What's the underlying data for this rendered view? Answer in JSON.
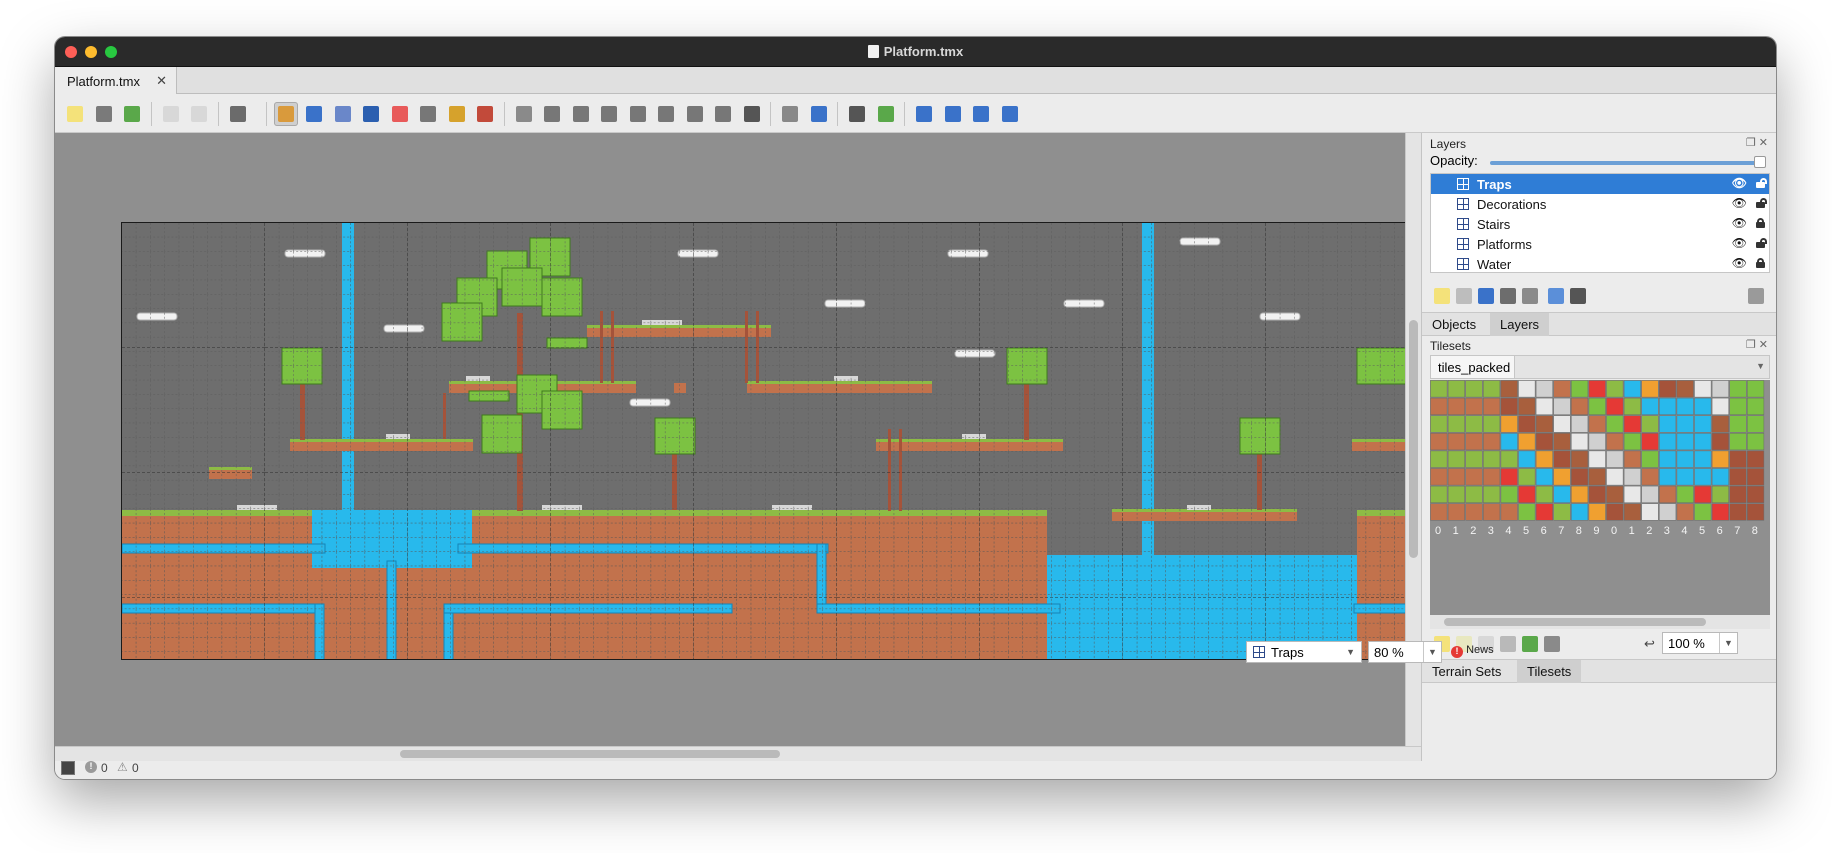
{
  "window": {
    "title": "Platform.tmx"
  },
  "tabs": [
    {
      "label": "Platform.tmx"
    }
  ],
  "toolbar": {
    "groups": [
      [
        "new-map-icon",
        "open-icon",
        "save-icon"
      ],
      [
        "undo-icon",
        "redo-icon"
      ],
      [
        "commands-icon"
      ],
      [
        "stamp-brush-icon",
        "terrain-brush-icon",
        "bucket-fill-icon",
        "shape-fill-icon",
        "eraser-icon",
        "rect-select-icon",
        "magic-wand-icon",
        "select-same-tile-icon"
      ],
      [
        "select-objects-icon",
        "edit-polygons-icon",
        "insert-rectangle-icon",
        "insert-point-icon",
        "insert-ellipse-icon",
        "insert-polygon-icon",
        "insert-tile-icon",
        "insert-template-icon",
        "insert-text-icon"
      ],
      [
        "layer-offset-icon",
        "world-tool-icon"
      ],
      [
        "random-mode-icon",
        "wang-fill-icon"
      ],
      [
        "flip-horizontal-icon",
        "flip-vertical-icon",
        "rotate-left-icon",
        "rotate-right-icon"
      ]
    ]
  },
  "layers_panel": {
    "title": "Layers",
    "opacity_label": "Opacity:",
    "opacity_value": 1.0,
    "layers": [
      {
        "name": "Traps",
        "selected": true,
        "visible": true,
        "locked": false
      },
      {
        "name": "Decorations",
        "selected": false,
        "visible": true,
        "locked": false
      },
      {
        "name": "Stairs",
        "selected": false,
        "visible": true,
        "locked": true
      },
      {
        "name": "Platforms",
        "selected": false,
        "visible": true,
        "locked": false
      },
      {
        "name": "Water",
        "selected": false,
        "visible": true,
        "locked": true
      }
    ],
    "tabs": [
      {
        "label": "Objects",
        "active": false
      },
      {
        "label": "Layers",
        "active": true
      }
    ]
  },
  "tilesets_panel": {
    "title": "Tilesets",
    "tileset_name": "tiles_packed",
    "digits": [
      "0",
      "1",
      "2",
      "3",
      "4",
      "5",
      "6",
      "7",
      "8",
      "9",
      "0",
      "1",
      "2",
      "3",
      "4",
      "5",
      "6",
      "7",
      "8"
    ],
    "zoom": "100 %",
    "tabs": [
      {
        "label": "Terrain Sets",
        "active": false
      },
      {
        "label": "Tilesets",
        "active": true
      }
    ]
  },
  "statusbar": {
    "errors": "0",
    "warnings": "0",
    "current_layer": "Traps",
    "zoom": "80 %",
    "news_label": "News"
  },
  "colors": {
    "canvas_bg": "#6e6e6e",
    "dirt": "#c2724c",
    "grass": "#8dbb45",
    "water": "#28b9ec",
    "selection": "#2f7dd6",
    "tree_leaf": "#7cc242",
    "trunk": "#a5533a"
  }
}
